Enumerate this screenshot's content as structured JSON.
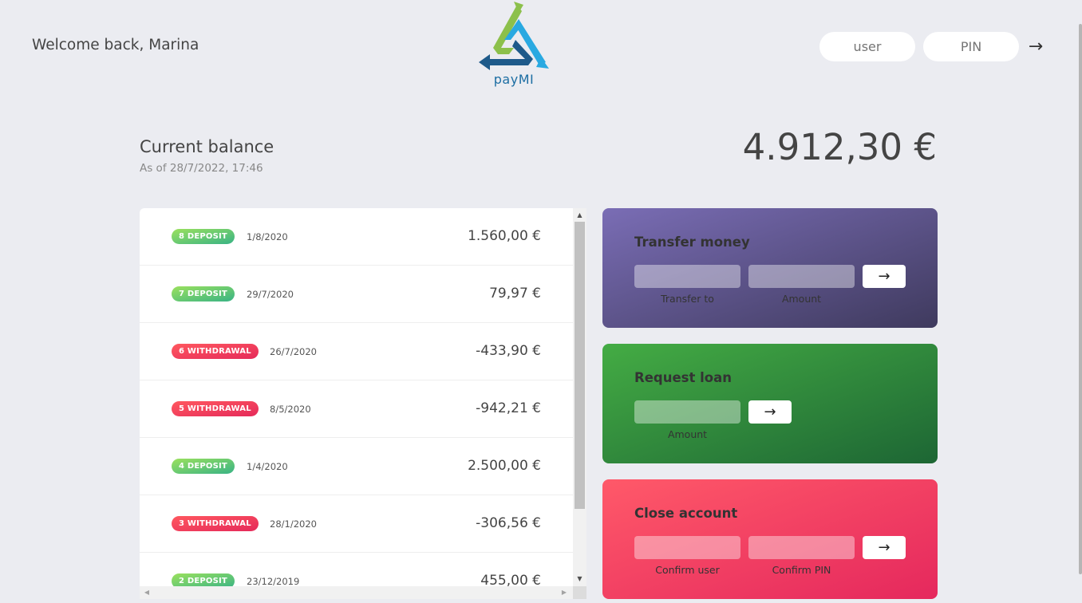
{
  "header": {
    "welcome": "Welcome back, Marina",
    "logo_text": "payMI",
    "user_placeholder": "user",
    "pin_placeholder": "PIN",
    "login_arrow": "→"
  },
  "balance": {
    "label": "Current balance",
    "date": "As of 28/7/2022, 17:46",
    "value": "4.912,30 €"
  },
  "movements": [
    {
      "type_label": "8 DEPOSIT",
      "kind": "deposit",
      "date": "1/8/2020",
      "value": "1.560,00 €"
    },
    {
      "type_label": "7 DEPOSIT",
      "kind": "deposit",
      "date": "29/7/2020",
      "value": "79,97 €"
    },
    {
      "type_label": "6 WITHDRAWAL",
      "kind": "withdrawal",
      "date": "26/7/2020",
      "value": "-433,90 €"
    },
    {
      "type_label": "5 WITHDRAWAL",
      "kind": "withdrawal",
      "date": "8/5/2020",
      "value": "-942,21 €"
    },
    {
      "type_label": "4 DEPOSIT",
      "kind": "deposit",
      "date": "1/4/2020",
      "value": "2.500,00 €"
    },
    {
      "type_label": "3 WITHDRAWAL",
      "kind": "withdrawal",
      "date": "28/1/2020",
      "value": "-306,56 €"
    },
    {
      "type_label": "2 DEPOSIT",
      "kind": "deposit",
      "date": "23/12/2019",
      "value": "455,00 €"
    }
  ],
  "operations": {
    "transfer": {
      "title": "Transfer money",
      "label_to": "Transfer to",
      "label_amount": "Amount",
      "button": "→"
    },
    "loan": {
      "title": "Request loan",
      "label_amount": "Amount",
      "button": "→"
    },
    "close": {
      "title": "Close account",
      "label_user": "Confirm user",
      "label_pin": "Confirm PIN",
      "button": "→"
    }
  },
  "colors": {
    "background": "#ebecf1",
    "deposit": "#39b385",
    "withdrawal": "#e52a5a",
    "transfer": "#5b4f8f",
    "loan": "#33963d",
    "close": "#f5465d"
  }
}
